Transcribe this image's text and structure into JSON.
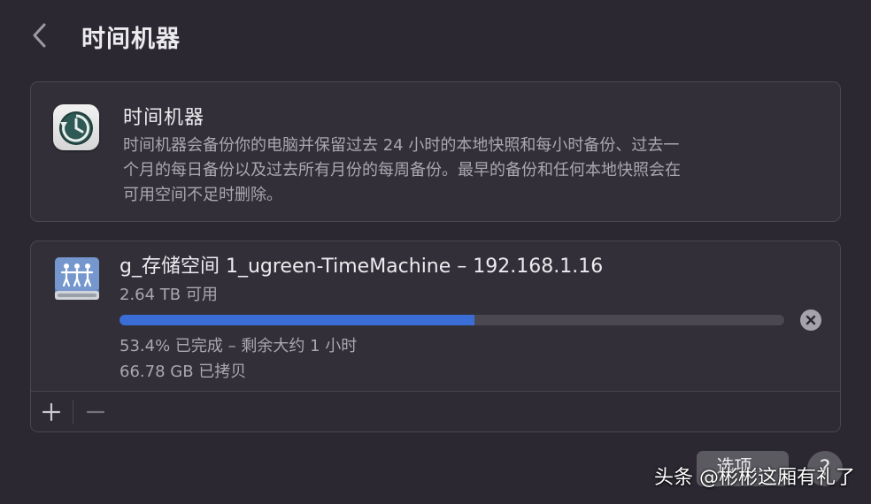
{
  "header": {
    "title": "时间机器",
    "back_icon": "chevron-left-icon"
  },
  "info": {
    "icon": "time-machine-app-icon",
    "title": "时间机器",
    "description_lines": [
      "时间机器会备份你的电脑并保留过去 24 小时的本地快照和每小时备份、过去一",
      "个月的每日备份以及过去所有月份的每周备份。最早的备份和任何本地快照会在",
      "可用空间不足时删除。"
    ]
  },
  "backup_disk": {
    "icon": "network-volume-icon",
    "name": "g_存储空间 1_ugreen-TimeMachine – 192.168.1.16",
    "available": "2.64 TB 可用",
    "progress_fraction": 0.534,
    "status": "53.4% 已完成 – 剩余大约 1 小时",
    "copied": "66.78 GB 已拷贝",
    "stop_icon": "stop-circle-icon"
  },
  "toolbar": {
    "add_label": "+",
    "remove_label": "−"
  },
  "footer": {
    "options_label": "选项...",
    "help_label": "?"
  },
  "watermark": "头条 @彬彬这厢有礼了",
  "colors": {
    "accent": "#3a6ed6",
    "background": "#2b2832",
    "panel": "#322f38"
  }
}
